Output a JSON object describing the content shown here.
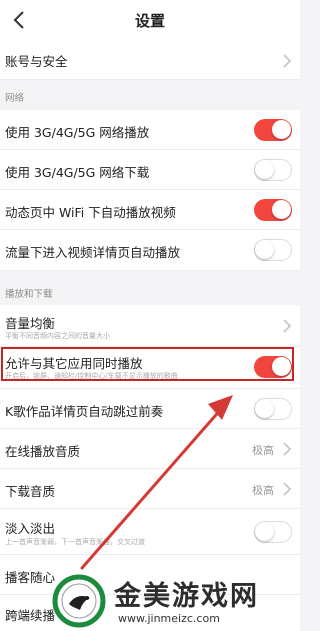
{
  "nav": {
    "back_icon": "back-chevron-icon",
    "title": "设置"
  },
  "rows": {
    "account": {
      "label": "账号与安全"
    },
    "net_play": {
      "label": "使用 3G/4G/5G 网络播放",
      "toggle": "on"
    },
    "net_download": {
      "label": "使用 3G/4G/5G 网络下载",
      "toggle": "off"
    },
    "wifi_autoplay": {
      "label": "动态页中 WiFi 下自动播放视频",
      "toggle": "on"
    },
    "traffic_autoplay": {
      "label": "流量下进入视频详情页自动播放",
      "toggle": "off"
    },
    "volume_balance": {
      "label": "音量均衡",
      "sub": "平衡不同音频内容之间的音量大小"
    },
    "allow_other_apps": {
      "label": "允许与其它应用同时播放",
      "sub": "开启后，锁屏、通知栏/控制中心/车载不显示播放的歌曲",
      "toggle": "on"
    },
    "kge_skip_intro": {
      "label": "K歌作品详情页自动跳过前奏",
      "toggle": "off"
    },
    "online_quality": {
      "label": "在线播放音质",
      "value": "极高"
    },
    "download_quality": {
      "label": "下载音质",
      "value": "极高"
    },
    "fade": {
      "label": "淡入淡出",
      "sub": "上一首声音渐弱，下一首声音渐强，交叉过渡",
      "toggle": "off"
    },
    "podcast": {
      "label": "播客随心"
    },
    "cross_device": {
      "label": "跨端续播"
    }
  },
  "sections": {
    "network": "网络",
    "playback_download": "播放和下载"
  },
  "watermark": {
    "name": "金美游戏网",
    "url": "www.jinmeizc.com"
  },
  "colors": {
    "accent": "#f0463e",
    "highlight_box": "#c8252b",
    "arrow": "#d43a35"
  }
}
